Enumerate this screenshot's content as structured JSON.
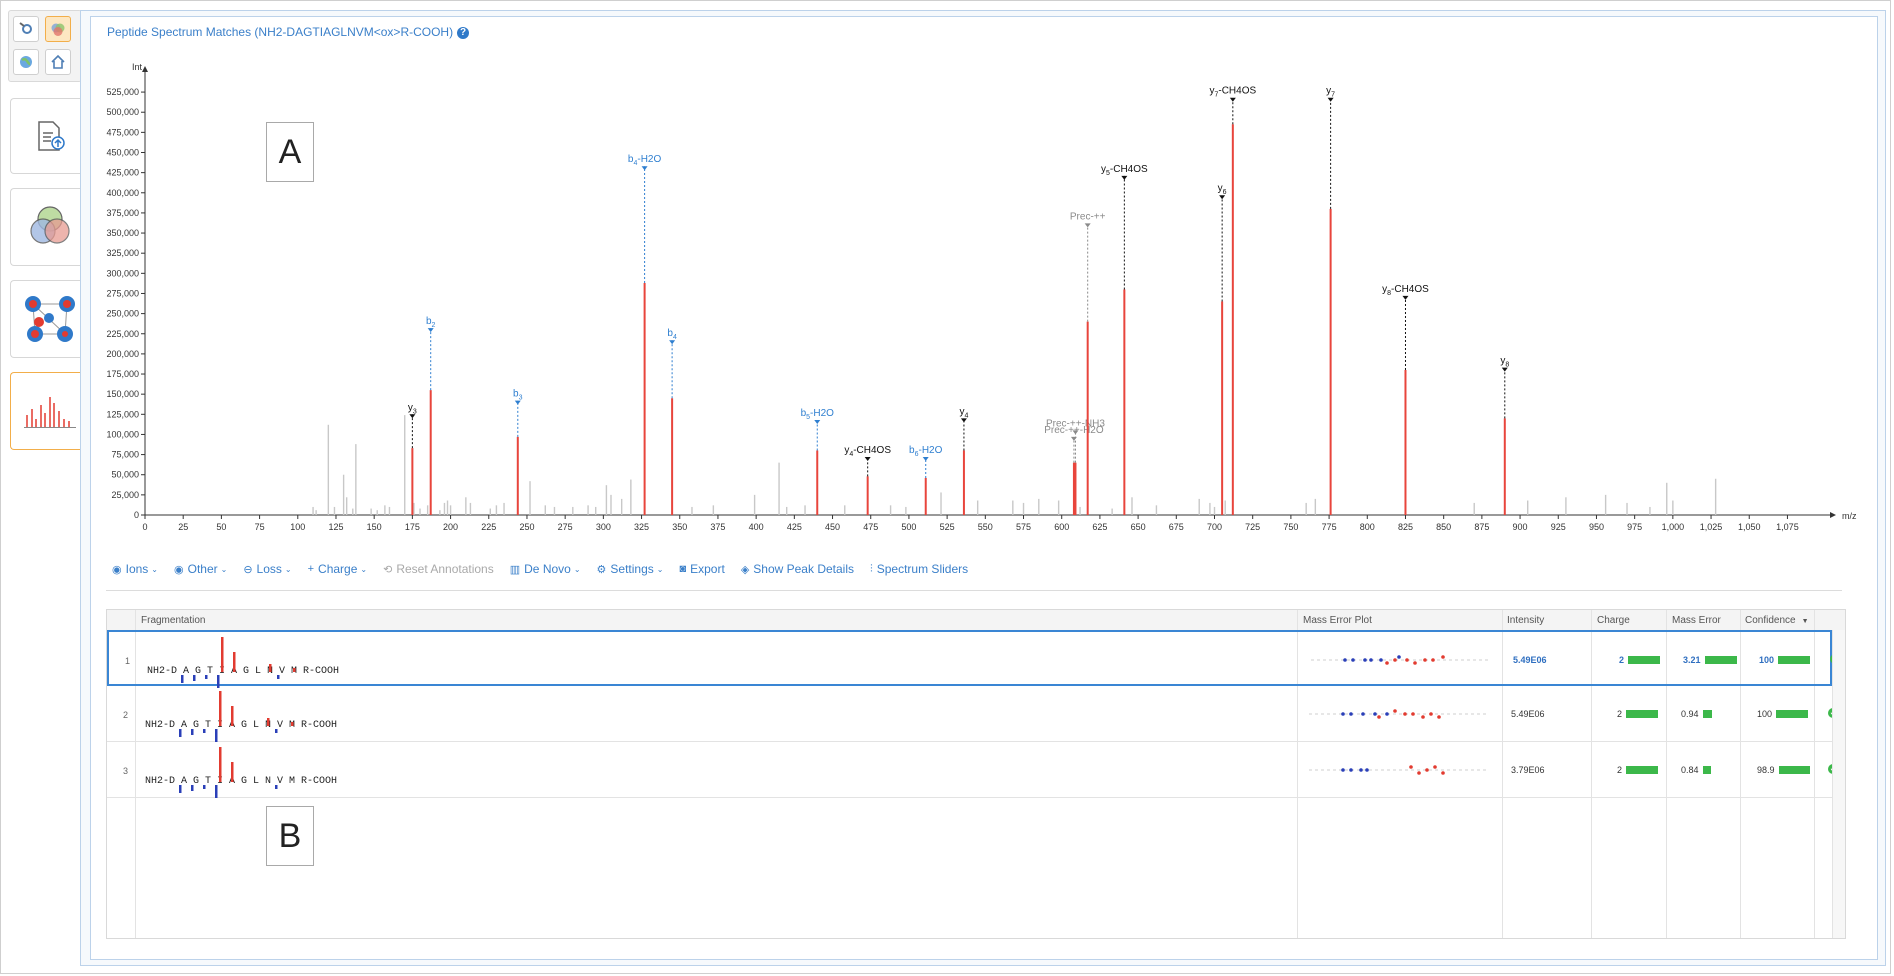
{
  "panel": {
    "title": "Peptide Spectrum Matches (NH2-DAGTIAGLNVM<ox>R-COOH)",
    "help_glyph": "?"
  },
  "overlay_labels": {
    "a": "A",
    "b": "B"
  },
  "toolbar": {
    "ions": "Ions",
    "other": "Other",
    "loss": "Loss",
    "charge": "Charge",
    "reset": "Reset Annotations",
    "denovo": "De Novo",
    "settings": "Settings",
    "export": "Export",
    "show_peak": "Show Peak Details",
    "sliders": "Spectrum Sliders"
  },
  "table": {
    "headers": {
      "fragmentation": "Fragmentation",
      "mass_error_plot": "Mass Error Plot",
      "intensity": "Intensity",
      "charge": "Charge",
      "mass_error": "Mass Error",
      "confidence": "Confidence"
    },
    "rows": [
      {
        "index": "1",
        "sequence": "NH2-D A G T I A G L N V M R-COOH",
        "intensity": "5.49E06",
        "charge": "2",
        "mass_error": "3.21",
        "confidence": "100",
        "selected": true
      },
      {
        "index": "2",
        "sequence": "NH2-D A G T I A G L N V M R-COOH",
        "intensity": "5.49E06",
        "charge": "2",
        "mass_error": "0.94",
        "confidence": "100",
        "selected": false
      },
      {
        "index": "3",
        "sequence": "NH2-D A G T I A G L N V M R-COOH",
        "intensity": "3.79E06",
        "charge": "2",
        "mass_error": "0.84",
        "confidence": "98.9",
        "selected": false
      }
    ]
  },
  "colors": {
    "accent": "#3a7fc9",
    "peak_annotated": "#e8453c",
    "peak_plain": "#c8c8c8",
    "b_ion": "#2f7fd0",
    "green": "#3cb84a"
  },
  "chart_data": {
    "type": "bar",
    "xlabel": "m/z",
    "ylabel": "Int",
    "xlim": [
      0,
      1095
    ],
    "ylim": [
      0,
      540000
    ],
    "xticks": [
      0,
      25,
      50,
      75,
      100,
      125,
      150,
      175,
      200,
      225,
      250,
      275,
      300,
      325,
      350,
      375,
      400,
      425,
      450,
      475,
      500,
      525,
      550,
      575,
      600,
      625,
      650,
      675,
      700,
      725,
      750,
      775,
      800,
      825,
      850,
      875,
      900,
      925,
      950,
      975,
      1000,
      1025,
      1050,
      1075
    ],
    "xtick_labels": [
      "0",
      "25",
      "50",
      "75",
      "100",
      "125",
      "150",
      "175",
      "200",
      "225",
      "250",
      "275",
      "300",
      "325",
      "350",
      "375",
      "400",
      "425",
      "450",
      "475",
      "500",
      "525",
      "550",
      "575",
      "600",
      "625",
      "650",
      "675",
      "700",
      "725",
      "750",
      "775",
      "800",
      "825",
      "850",
      "875",
      "900",
      "925",
      "950",
      "975",
      "1,000",
      "1,025",
      "1,050",
      "1,075"
    ],
    "yticks": [
      0,
      25000,
      50000,
      75000,
      100000,
      125000,
      150000,
      175000,
      200000,
      225000,
      250000,
      275000,
      300000,
      325000,
      350000,
      375000,
      400000,
      425000,
      450000,
      475000,
      500000,
      525000
    ],
    "ytick_labels": [
      "0",
      "25,000",
      "50,000",
      "75,000",
      "100,000",
      "125,000",
      "150,000",
      "175,000",
      "200,000",
      "225,000",
      "250,000",
      "275,000",
      "300,000",
      "325,000",
      "350,000",
      "375,000",
      "400,000",
      "425,000",
      "450,000",
      "475,000",
      "500,000",
      "525,000"
    ],
    "annotated_peaks": [
      {
        "label": "y",
        "sub": "3",
        "suffix": "",
        "mz": 175,
        "intensity": 83000,
        "label_intensity": 125000,
        "type": "y"
      },
      {
        "label": "b",
        "sub": "2",
        "suffix": "",
        "mz": 187,
        "intensity": 155000,
        "label_intensity": 232000,
        "type": "b"
      },
      {
        "label": "b",
        "sub": "3",
        "suffix": "",
        "mz": 244,
        "intensity": 97000,
        "label_intensity": 142000,
        "type": "b"
      },
      {
        "label": "b",
        "sub": "4",
        "suffix": "-H2O",
        "mz": 327,
        "intensity": 288000,
        "label_intensity": 433000,
        "type": "b"
      },
      {
        "label": "b",
        "sub": "4",
        "suffix": "",
        "mz": 345,
        "intensity": 145000,
        "label_intensity": 217000,
        "type": "b"
      },
      {
        "label": "b",
        "sub": "5",
        "suffix": "-H2O",
        "mz": 440,
        "intensity": 80000,
        "label_intensity": 118000,
        "type": "b"
      },
      {
        "label": "y",
        "sub": "4",
        "suffix": "-CH4OS",
        "mz": 473,
        "intensity": 48000,
        "label_intensity": 72000,
        "type": "y"
      },
      {
        "label": "b",
        "sub": "6",
        "suffix": "-H2O",
        "mz": 511,
        "intensity": 46000,
        "label_intensity": 72000,
        "type": "b"
      },
      {
        "label": "y",
        "sub": "4",
        "suffix": "",
        "mz": 536,
        "intensity": 80000,
        "label_intensity": 120000,
        "type": "y"
      },
      {
        "label": "Prec-++-H2O",
        "sub": "",
        "suffix": "",
        "mz": 608,
        "intensity": 65000,
        "label_intensity": 97000,
        "type": "prec"
      },
      {
        "label": "Prec-++-NH3",
        "sub": "",
        "suffix": "",
        "mz": 609,
        "intensity": 65000,
        "label_intensity": 105000,
        "type": "prec"
      },
      {
        "label": "Prec-++",
        "sub": "",
        "suffix": "",
        "mz": 617,
        "intensity": 240000,
        "label_intensity": 362000,
        "type": "prec"
      },
      {
        "label": "y",
        "sub": "5",
        "suffix": "-CH4OS",
        "mz": 641,
        "intensity": 280000,
        "label_intensity": 421000,
        "type": "y"
      },
      {
        "label": "y",
        "sub": "6",
        "suffix": "",
        "mz": 705,
        "intensity": 265000,
        "label_intensity": 397000,
        "type": "y"
      },
      {
        "label": "y",
        "sub": "7",
        "suffix": "-CH4OS",
        "mz": 712,
        "intensity": 485000,
        "label_intensity": 518000,
        "type": "y"
      },
      {
        "label": "y",
        "sub": "7",
        "suffix": "",
        "mz": 776,
        "intensity": 380000,
        "label_intensity": 518000,
        "type": "y"
      },
      {
        "label": "y",
        "sub": "8",
        "suffix": "-CH4OS",
        "mz": 825,
        "intensity": 180000,
        "label_intensity": 272000,
        "type": "y"
      },
      {
        "label": "y",
        "sub": "8",
        "suffix": "",
        "mz": 890,
        "intensity": 120000,
        "label_intensity": 183000,
        "type": "y"
      }
    ],
    "unannotated_peaks": [
      [
        110,
        10000
      ],
      [
        112,
        6000
      ],
      [
        120,
        112000
      ],
      [
        124,
        10000
      ],
      [
        130,
        50000
      ],
      [
        132,
        22000
      ],
      [
        136,
        8000
      ],
      [
        138,
        88000
      ],
      [
        148,
        8000
      ],
      [
        152,
        6000
      ],
      [
        157,
        12000
      ],
      [
        160,
        10000
      ],
      [
        170,
        124000
      ],
      [
        176,
        15000
      ],
      [
        180,
        8000
      ],
      [
        185,
        12000
      ],
      [
        193,
        6000
      ],
      [
        196,
        15000
      ],
      [
        198,
        18000
      ],
      [
        200,
        12000
      ],
      [
        210,
        22000
      ],
      [
        213,
        15000
      ],
      [
        226,
        8000
      ],
      [
        230,
        12000
      ],
      [
        235,
        15000
      ],
      [
        252,
        42000
      ],
      [
        262,
        12000
      ],
      [
        268,
        10000
      ],
      [
        280,
        10000
      ],
      [
        290,
        12000
      ],
      [
        295,
        10000
      ],
      [
        302,
        37000
      ],
      [
        305,
        25000
      ],
      [
        312,
        20000
      ],
      [
        318,
        44000
      ],
      [
        358,
        10000
      ],
      [
        372,
        12000
      ],
      [
        399,
        25000
      ],
      [
        415,
        65000
      ],
      [
        420,
        10000
      ],
      [
        432,
        12000
      ],
      [
        458,
        12000
      ],
      [
        488,
        12000
      ],
      [
        498,
        10000
      ],
      [
        521,
        28000
      ],
      [
        545,
        18000
      ],
      [
        568,
        18000
      ],
      [
        575,
        15000
      ],
      [
        585,
        20000
      ],
      [
        598,
        18000
      ],
      [
        612,
        10000
      ],
      [
        633,
        8000
      ],
      [
        646,
        22000
      ],
      [
        662,
        12000
      ],
      [
        690,
        20000
      ],
      [
        697,
        15000
      ],
      [
        700,
        10000
      ],
      [
        707,
        18000
      ],
      [
        760,
        15000
      ],
      [
        766,
        20000
      ],
      [
        870,
        15000
      ],
      [
        905,
        18000
      ],
      [
        930,
        22000
      ],
      [
        956,
        25000
      ],
      [
        970,
        15000
      ],
      [
        985,
        10000
      ],
      [
        996,
        40000
      ],
      [
        1000,
        18000
      ],
      [
        1028,
        45000
      ]
    ]
  }
}
